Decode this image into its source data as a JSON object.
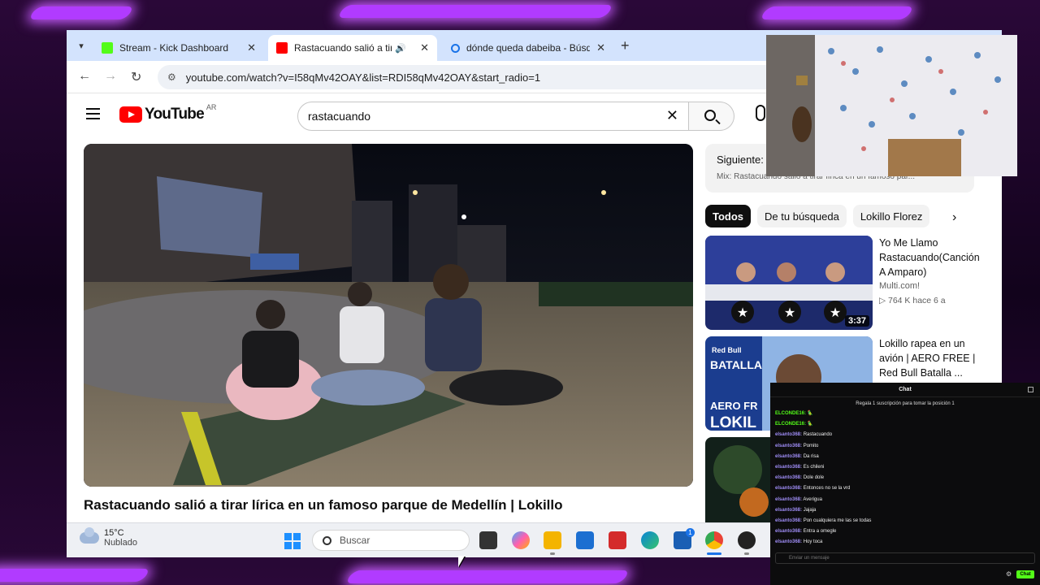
{
  "browser": {
    "tabs": [
      {
        "title": "Stream - Kick Dashboard",
        "favicon_color": "#53fc18"
      },
      {
        "title": "Rastacuando salió a tirar líri",
        "favicon_color": "#ff0000"
      },
      {
        "title": "dónde queda dabeiba - Búsque",
        "favicon_color": "#1a73e8"
      }
    ],
    "url": "youtube.com/watch?v=I58qMv42OAY&list=RDI58qMv42OAY&start_radio=1"
  },
  "youtube": {
    "logo_text": "YouTube",
    "country_code": "AR",
    "search_value": "rastacuando",
    "video_title": "Rastacuando salió a tirar lírica en un famoso parque de Medellín | Lokillo",
    "playlist": {
      "next_label": "Siguiente:",
      "mix_text": "Mix: Rastacuando salió a tirar lírica en un famoso par..."
    },
    "chips": [
      "Todos",
      "De tu búsqueda",
      "Lokillo Florez"
    ],
    "recommendations": [
      {
        "title": "Yo Me Llamo Rastacuando(Canción A Amparo)",
        "channel": "Multi.com!",
        "stats": "▷ 764 K  hace 6 a",
        "duration": "3:37"
      },
      {
        "title": "Lokillo rapea en un avión | AERO FREE | Red Bull Batalla ...",
        "channel": "",
        "stats": "",
        "duration": ""
      },
      {
        "title": "",
        "channel": "",
        "stats": "",
        "duration": ""
      }
    ],
    "thumb_texts": {
      "batalla": "BATALLA",
      "redbull": "Red Bull",
      "aero": "AERO FR",
      "lokillo": "LOKIL"
    }
  },
  "taskbar": {
    "temperature": "15°C",
    "condition": "Nublado",
    "search_placeholder": "Buscar",
    "notification_count": "1"
  },
  "chat": {
    "header": "Chat",
    "pinned": "Regala 1 suscripción para tomar la posición 1",
    "messages": [
      {
        "user": "ELCONDE16:",
        "text": "🦜",
        "green": true
      },
      {
        "user": "ELCONDE16:",
        "text": "🦜",
        "green": true
      },
      {
        "user": "elsanto368:",
        "text": "Rastacuando",
        "green": false
      },
      {
        "user": "elsanto368:",
        "text": "Pomito",
        "green": false
      },
      {
        "user": "elsanto368:",
        "text": "Da risa",
        "green": false
      },
      {
        "user": "elsanto368:",
        "text": "Es chileni",
        "green": false
      },
      {
        "user": "elsanto368:",
        "text": "Dole dole",
        "green": false
      },
      {
        "user": "elsanto368:",
        "text": "Entonces no se la vrd",
        "green": false
      },
      {
        "user": "elsanto368:",
        "text": "Averigua",
        "green": false
      },
      {
        "user": "elsanto368:",
        "text": "Jajaja",
        "green": false
      },
      {
        "user": "elsanto368:",
        "text": "Pon cualquiera me las se todas",
        "green": false
      },
      {
        "user": "elsanto368:",
        "text": "Entra a omegle",
        "green": false
      },
      {
        "user": "elsanto368:",
        "text": "Hoy toca",
        "green": false
      }
    ],
    "input_placeholder": "Enviar un mensaje",
    "send_label": "Chat"
  }
}
